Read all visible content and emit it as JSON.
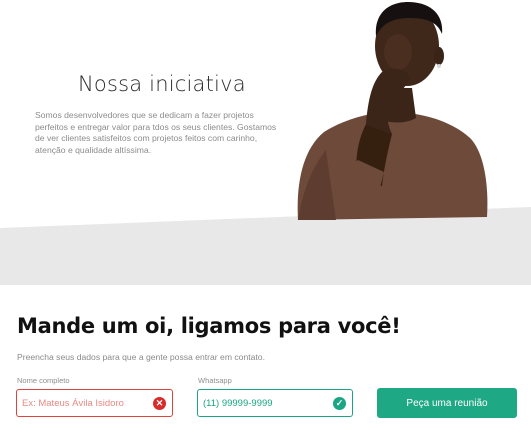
{
  "hero": {
    "title": "Nossa iniciativa",
    "description": "Somos desenvolvedores que se dedicam a fazer projetos perfeitos e entregar valor para tdos os seus clientes. Gostamos de ver clientes satisfeitos com projetos feitos com carinho, atenção e qualidade altíssima."
  },
  "form": {
    "title": "Mande um oi, ligamos para você!",
    "subtitle": "Preencha seus dados para que a gente possa entrar em contato.",
    "name_field": {
      "label": "Nome completo",
      "placeholder": "Ex: Mateus Ávila Isidoro",
      "value": "",
      "status": "error"
    },
    "phone_field": {
      "label": "Whatsapp",
      "placeholder": "(11) 99999-9999",
      "value": "(11) 99999-9999",
      "status": "valid"
    },
    "submit_label": "Peça uma reunião"
  },
  "colors": {
    "accent": "#1ea884",
    "error": "#e0423c",
    "band": "#e8e8e8"
  },
  "icons": {
    "error_icon": "close-circle-icon",
    "valid_icon": "check-circle-icon"
  }
}
